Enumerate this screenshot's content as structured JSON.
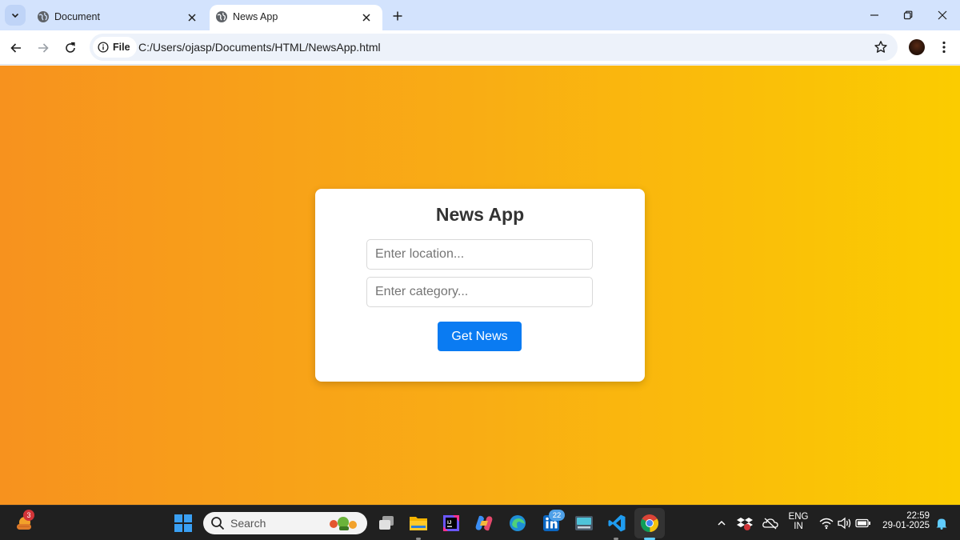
{
  "browser": {
    "tabs": [
      {
        "title": "Document",
        "active": false
      },
      {
        "title": "News App",
        "active": true
      }
    ],
    "address": {
      "chip_label": "File",
      "url": "C:/Users/ojasp/Documents/HTML/NewsApp.html"
    }
  },
  "page": {
    "heading": "News App",
    "location_placeholder": "Enter location...",
    "category_placeholder": "Enter category...",
    "button_label": "Get News",
    "colors": {
      "gradient_start": "#f7921e",
      "gradient_end": "#fbcc00",
      "button": "#0a7bf2"
    }
  },
  "taskbar": {
    "weather_badge": "3",
    "search_placeholder": "Search",
    "linkedin_badge": "22",
    "apps": [
      "windows-start-icon",
      "task-view-icon",
      "file-explorer-icon",
      "jetbrains-icon",
      "copilot-icon",
      "edge-icon",
      "linkedin-icon",
      "keyboard-app-icon",
      "vscode-icon",
      "chrome-icon"
    ],
    "tray": {
      "language_line1": "ENG",
      "language_line2": "IN",
      "time": "22:59",
      "date": "29-01-2025"
    }
  }
}
